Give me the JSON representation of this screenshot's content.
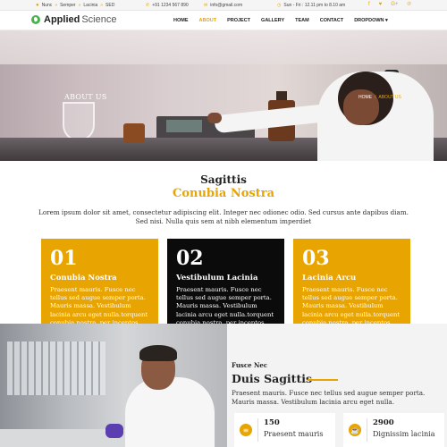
{
  "topbar": {
    "address": [
      "Nunc",
      "Semper",
      "Lacinia",
      "SED"
    ],
    "phone": "+91 1234 567 890",
    "email": "info@gmail.com",
    "hours": "Sun - Fri : 12.11 pm to 8.10 am",
    "social": [
      {
        "icon": "facebook-icon",
        "glyph": "f"
      },
      {
        "icon": "twitter-icon",
        "glyph": "♥"
      },
      {
        "icon": "google-plus-icon",
        "glyph": "G+"
      },
      {
        "icon": "pinterest-icon",
        "glyph": "℗"
      }
    ]
  },
  "brand": {
    "name_bold": "Applied",
    "name_light": "Science"
  },
  "nav": {
    "items": [
      "HOME",
      "ABOUT",
      "PROJECT",
      "GALLERY",
      "TEAM",
      "CONTACT",
      "DROPDOWN ▾"
    ],
    "active_index": 1
  },
  "hero": {
    "title": "ABOUT US",
    "breadcrumb": [
      "HOME",
      "ABOUT US"
    ]
  },
  "intro": {
    "subtitle": "Sagittis",
    "title": "Conubia Nostra",
    "text": "Lorem ipsum dolor sit amet, consectetur adipiscing elit. Integer nec odionec odio. Sed cursus ante dapibus diam. Sed nisi. Nulla quis sem at nibh elementum imperdiet"
  },
  "cards": [
    {
      "num": "01",
      "title": "Conubia Nostra",
      "text": "Praesent mauris. Fusce nec tellus sed augue semper porta. Mauris massa. Vestibulum lacinia arcu eget nulla.torquent conubia nostra, per inceptos",
      "color": "#e8a400"
    },
    {
      "num": "02",
      "title": "Vestibulum Lacinia",
      "text": "Praesent mauris. Fusce nec tellus sed augue semper porta. Mauris massa. Vestibulum lacinia arcu eget nulla.torquent conubia nostra, per inceptos",
      "color": "#0b0b0b"
    },
    {
      "num": "03",
      "title": "Lacinia Arcu",
      "text": "Praesent mauris. Fusce nec tellus sed augue semper porta. Mauris massa. Vestibulum lacinia arcu eget nulla.torquent conubia nostra, per inceptos",
      "color": "#e8a400"
    }
  ],
  "bottom": {
    "eyebrow": "Fusce Nec",
    "title": "Duis Sagittis",
    "text": "Praesent mauris. Fusce nec tellus sed augue semper porta. Mauris massa. Vestibulum lacinia arcu eget nulla.",
    "stats": [
      {
        "value": "150",
        "label": "Praesent mauris",
        "icon": "coins-icon"
      },
      {
        "value": "2900",
        "label": "Dignissim lacinia",
        "icon": "coffee-icon"
      }
    ]
  },
  "colors": {
    "accent": "#e8a400",
    "dark": "#0b0b0b"
  }
}
